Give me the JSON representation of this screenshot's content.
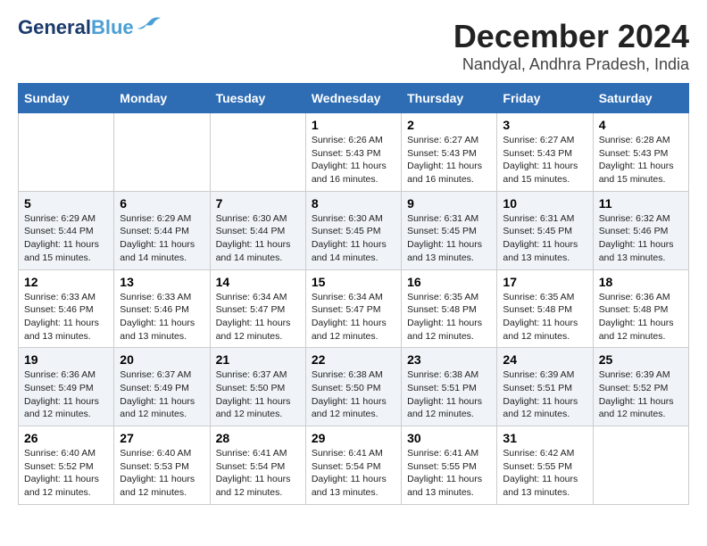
{
  "logo": {
    "line1": "General",
    "line2": "Blue"
  },
  "title": "December 2024",
  "location": "Nandyal, Andhra Pradesh, India",
  "weekdays": [
    "Sunday",
    "Monday",
    "Tuesday",
    "Wednesday",
    "Thursday",
    "Friday",
    "Saturday"
  ],
  "days": [
    null,
    null,
    null,
    {
      "num": "1",
      "sunrise": "6:26 AM",
      "sunset": "5:43 PM",
      "daylight": "11 hours and 16 minutes."
    },
    {
      "num": "2",
      "sunrise": "6:27 AM",
      "sunset": "5:43 PM",
      "daylight": "11 hours and 16 minutes."
    },
    {
      "num": "3",
      "sunrise": "6:27 AM",
      "sunset": "5:43 PM",
      "daylight": "11 hours and 15 minutes."
    },
    {
      "num": "4",
      "sunrise": "6:28 AM",
      "sunset": "5:43 PM",
      "daylight": "11 hours and 15 minutes."
    },
    {
      "num": "5",
      "sunrise": "6:29 AM",
      "sunset": "5:44 PM",
      "daylight": "11 hours and 15 minutes."
    },
    {
      "num": "6",
      "sunrise": "6:29 AM",
      "sunset": "5:44 PM",
      "daylight": "11 hours and 14 minutes."
    },
    {
      "num": "7",
      "sunrise": "6:30 AM",
      "sunset": "5:44 PM",
      "daylight": "11 hours and 14 minutes."
    },
    {
      "num": "8",
      "sunrise": "6:30 AM",
      "sunset": "5:45 PM",
      "daylight": "11 hours and 14 minutes."
    },
    {
      "num": "9",
      "sunrise": "6:31 AM",
      "sunset": "5:45 PM",
      "daylight": "11 hours and 13 minutes."
    },
    {
      "num": "10",
      "sunrise": "6:31 AM",
      "sunset": "5:45 PM",
      "daylight": "11 hours and 13 minutes."
    },
    {
      "num": "11",
      "sunrise": "6:32 AM",
      "sunset": "5:46 PM",
      "daylight": "11 hours and 13 minutes."
    },
    {
      "num": "12",
      "sunrise": "6:33 AM",
      "sunset": "5:46 PM",
      "daylight": "11 hours and 13 minutes."
    },
    {
      "num": "13",
      "sunrise": "6:33 AM",
      "sunset": "5:46 PM",
      "daylight": "11 hours and 13 minutes."
    },
    {
      "num": "14",
      "sunrise": "6:34 AM",
      "sunset": "5:47 PM",
      "daylight": "11 hours and 12 minutes."
    },
    {
      "num": "15",
      "sunrise": "6:34 AM",
      "sunset": "5:47 PM",
      "daylight": "11 hours and 12 minutes."
    },
    {
      "num": "16",
      "sunrise": "6:35 AM",
      "sunset": "5:48 PM",
      "daylight": "11 hours and 12 minutes."
    },
    {
      "num": "17",
      "sunrise": "6:35 AM",
      "sunset": "5:48 PM",
      "daylight": "11 hours and 12 minutes."
    },
    {
      "num": "18",
      "sunrise": "6:36 AM",
      "sunset": "5:48 PM",
      "daylight": "11 hours and 12 minutes."
    },
    {
      "num": "19",
      "sunrise": "6:36 AM",
      "sunset": "5:49 PM",
      "daylight": "11 hours and 12 minutes."
    },
    {
      "num": "20",
      "sunrise": "6:37 AM",
      "sunset": "5:49 PM",
      "daylight": "11 hours and 12 minutes."
    },
    {
      "num": "21",
      "sunrise": "6:37 AM",
      "sunset": "5:50 PM",
      "daylight": "11 hours and 12 minutes."
    },
    {
      "num": "22",
      "sunrise": "6:38 AM",
      "sunset": "5:50 PM",
      "daylight": "11 hours and 12 minutes."
    },
    {
      "num": "23",
      "sunrise": "6:38 AM",
      "sunset": "5:51 PM",
      "daylight": "11 hours and 12 minutes."
    },
    {
      "num": "24",
      "sunrise": "6:39 AM",
      "sunset": "5:51 PM",
      "daylight": "11 hours and 12 minutes."
    },
    {
      "num": "25",
      "sunrise": "6:39 AM",
      "sunset": "5:52 PM",
      "daylight": "11 hours and 12 minutes."
    },
    {
      "num": "26",
      "sunrise": "6:40 AM",
      "sunset": "5:52 PM",
      "daylight": "11 hours and 12 minutes."
    },
    {
      "num": "27",
      "sunrise": "6:40 AM",
      "sunset": "5:53 PM",
      "daylight": "11 hours and 12 minutes."
    },
    {
      "num": "28",
      "sunrise": "6:41 AM",
      "sunset": "5:54 PM",
      "daylight": "11 hours and 12 minutes."
    },
    {
      "num": "29",
      "sunrise": "6:41 AM",
      "sunset": "5:54 PM",
      "daylight": "11 hours and 13 minutes."
    },
    {
      "num": "30",
      "sunrise": "6:41 AM",
      "sunset": "5:55 PM",
      "daylight": "11 hours and 13 minutes."
    },
    {
      "num": "31",
      "sunrise": "6:42 AM",
      "sunset": "5:55 PM",
      "daylight": "11 hours and 13 minutes."
    }
  ]
}
